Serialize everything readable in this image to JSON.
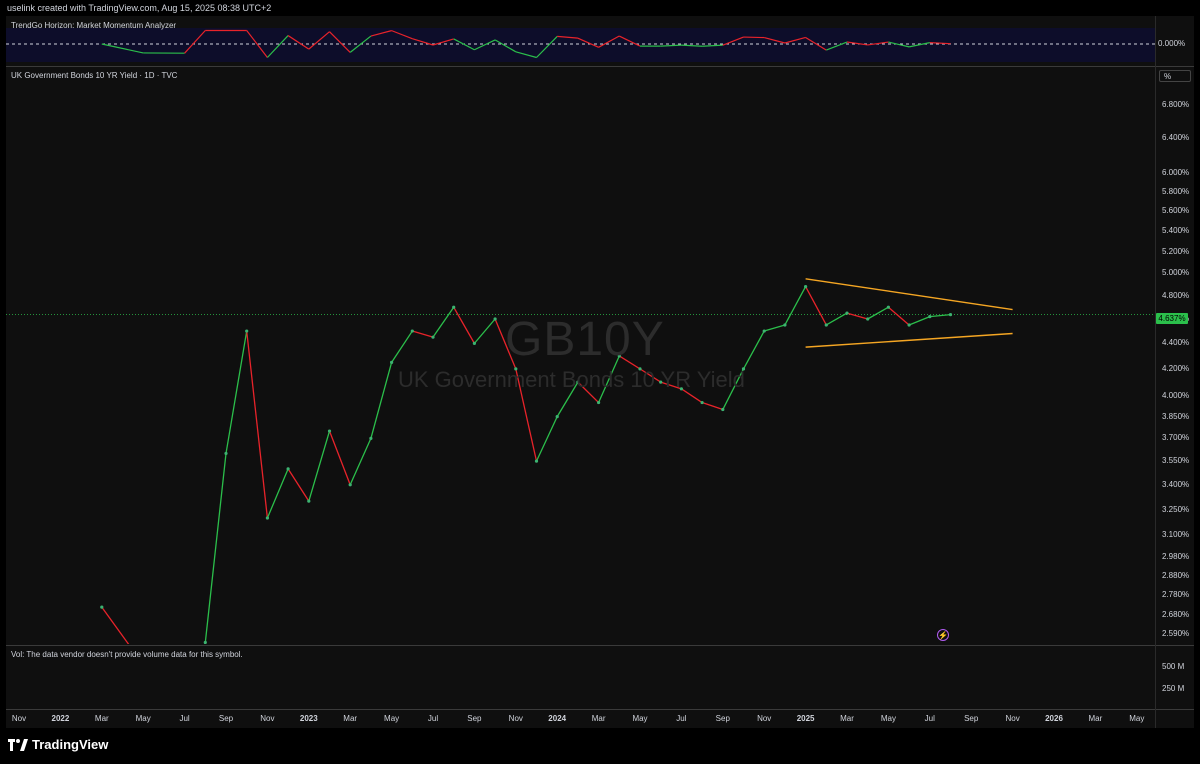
{
  "caption": "uselink created with TradingView.com, Aug 15, 2025 08:38 UTC+2",
  "brand": {
    "name": "TradingView",
    "icon": "tradingview-logo-icon"
  },
  "oscillator": {
    "title": "TrendGo Horizon: Market Momentum Analyzer",
    "zero_label": "0.000%"
  },
  "main": {
    "title": "UK Government Bonds 10 YR Yield · 1D · TVC",
    "unit": "%",
    "watermark": "GB10Y",
    "watermark_sub": "UK Government Bonds 10 YR Yield",
    "last_price_label": "4.637%",
    "y_ticks": [
      "6.800%",
      "6.400%",
      "6.000%",
      "5.800%",
      "5.600%",
      "5.400%",
      "5.200%",
      "5.000%",
      "4.800%",
      "4.600%",
      "4.400%",
      "4.200%",
      "4.000%",
      "3.850%",
      "3.700%",
      "3.550%",
      "3.400%",
      "3.250%",
      "3.100%",
      "2.980%",
      "2.880%",
      "2.780%",
      "2.680%",
      "2.590%"
    ],
    "alert_icon": "lightning-icon"
  },
  "volume": {
    "note": "Vol: The data vendor doesn't provide volume data for this symbol.",
    "ticks": [
      "500 M",
      "250 M"
    ]
  },
  "x_ticks": [
    {
      "label": "Nov",
      "bold": false
    },
    {
      "label": "2022",
      "bold": true
    },
    {
      "label": "Mar",
      "bold": false
    },
    {
      "label": "May",
      "bold": false
    },
    {
      "label": "Jul",
      "bold": false
    },
    {
      "label": "Sep",
      "bold": false
    },
    {
      "label": "Nov",
      "bold": false
    },
    {
      "label": "2023",
      "bold": true
    },
    {
      "label": "Mar",
      "bold": false
    },
    {
      "label": "May",
      "bold": false
    },
    {
      "label": "Jul",
      "bold": false
    },
    {
      "label": "Sep",
      "bold": false
    },
    {
      "label": "Nov",
      "bold": false
    },
    {
      "label": "2024",
      "bold": true
    },
    {
      "label": "Mar",
      "bold": false
    },
    {
      "label": "May",
      "bold": false
    },
    {
      "label": "Jul",
      "bold": false
    },
    {
      "label": "Sep",
      "bold": false
    },
    {
      "label": "Nov",
      "bold": false
    },
    {
      "label": "2025",
      "bold": true
    },
    {
      "label": "Mar",
      "bold": false
    },
    {
      "label": "May",
      "bold": false
    },
    {
      "label": "Jul",
      "bold": false
    },
    {
      "label": "Sep",
      "bold": false
    },
    {
      "label": "Nov",
      "bold": false
    },
    {
      "label": "2026",
      "bold": true
    },
    {
      "label": "Mar",
      "bold": false
    },
    {
      "label": "May",
      "bold": false
    }
  ],
  "chart_data": {
    "type": "line",
    "title": "UK Government Bonds 10 YR Yield · 1D · TVC",
    "ylabel": "%",
    "ylim": [
      2.55,
      7.0
    ],
    "y_scale": "log",
    "series": [
      {
        "name": "GB10Y",
        "color": "#3cb371",
        "x": [
          "2022-03",
          "2022-05",
          "2022-07",
          "2022-08",
          "2022-09",
          "2022-10",
          "2022-11",
          "2022-12",
          "2023-01",
          "2023-02",
          "2023-03",
          "2023-04",
          "2023-05",
          "2023-06",
          "2023-07",
          "2023-08",
          "2023-09",
          "2023-10",
          "2023-11",
          "2023-12",
          "2024-01",
          "2024-02",
          "2024-03",
          "2024-04",
          "2024-05",
          "2024-06",
          "2024-07",
          "2024-08",
          "2024-09",
          "2024-10",
          "2024-11",
          "2024-12",
          "2025-01",
          "2025-02",
          "2025-03",
          "2025-04",
          "2025-05",
          "2025-06",
          "2025-07",
          "2025-08"
        ],
        "values": [
          2.72,
          2.45,
          2.2,
          2.55,
          3.6,
          4.5,
          3.2,
          3.5,
          3.3,
          3.75,
          3.4,
          3.7,
          4.25,
          4.5,
          4.45,
          4.7,
          4.4,
          4.6,
          4.2,
          3.55,
          3.85,
          4.1,
          3.95,
          4.3,
          4.2,
          4.1,
          4.05,
          3.95,
          3.9,
          4.2,
          4.5,
          4.55,
          4.88,
          4.55,
          4.65,
          4.6,
          4.7,
          4.55,
          4.62,
          4.637
        ]
      }
    ],
    "annotations": [
      {
        "type": "trendline",
        "label": "upper",
        "from": [
          "2025-01",
          4.95
        ],
        "to": [
          "2025-11",
          4.68
        ],
        "color": "#f5a623"
      },
      {
        "type": "trendline",
        "label": "lower",
        "from": [
          "2025-01",
          4.37
        ],
        "to": [
          "2025-11",
          4.48
        ],
        "color": "#f5a623"
      },
      {
        "type": "hline",
        "value": 4.637,
        "color": "#2bbf4b",
        "style": "dotted"
      }
    ],
    "grid": false
  }
}
